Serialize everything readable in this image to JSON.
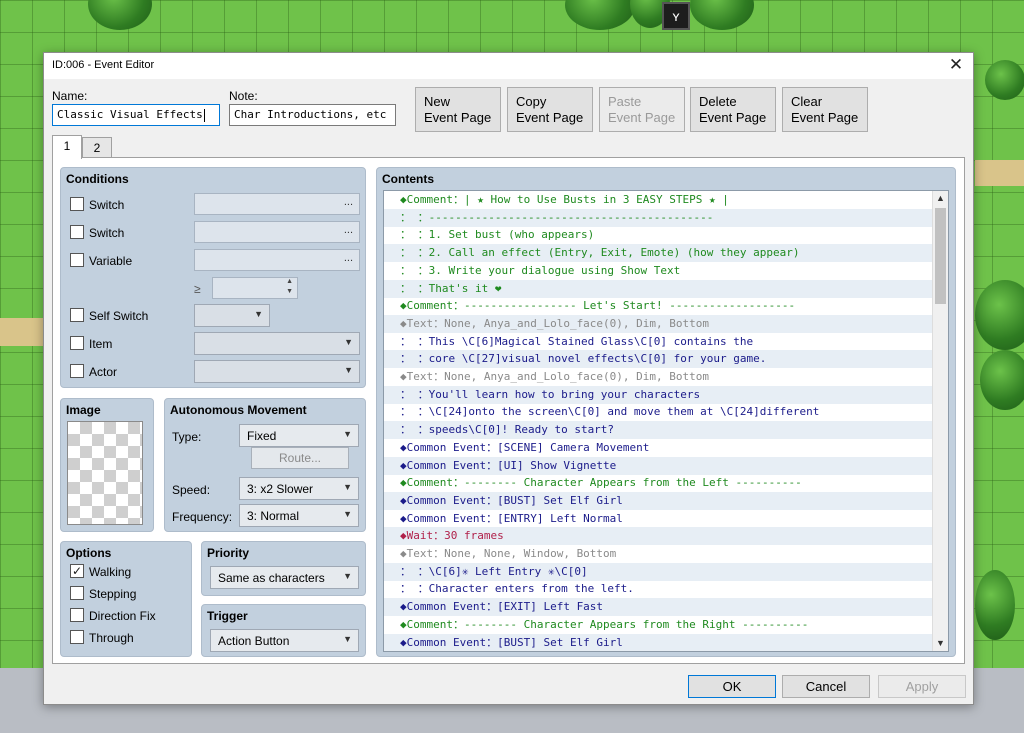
{
  "window": {
    "title": "ID:006 - Event Editor",
    "close": "✕"
  },
  "name": {
    "label": "Name:",
    "value": "Classic Visual Effects"
  },
  "note": {
    "label": "Note:",
    "value": "Char Introductions, etc"
  },
  "page_buttons": [
    {
      "line1": "New",
      "line2": "Event Page",
      "enabled": true
    },
    {
      "line1": "Copy",
      "line2": "Event Page",
      "enabled": true
    },
    {
      "line1": "Paste",
      "line2": "Event Page",
      "enabled": false
    },
    {
      "line1": "Delete",
      "line2": "Event Page",
      "enabled": true
    },
    {
      "line1": "Clear",
      "line2": "Event Page",
      "enabled": true
    }
  ],
  "tabs": [
    "1",
    "2"
  ],
  "conditions": {
    "title": "Conditions",
    "switch1": "Switch",
    "switch2": "Switch",
    "variable": "Variable",
    "gte": "≥",
    "self_switch": "Self Switch",
    "item": "Item",
    "actor": "Actor",
    "ellipsis": "...",
    "stepper_up": "▲",
    "stepper_down": "▼"
  },
  "image": {
    "title": "Image"
  },
  "autonomous": {
    "title": "Autonomous Movement",
    "type_label": "Type:",
    "type_value": "Fixed",
    "route": "Route...",
    "speed_label": "Speed:",
    "speed_value": "3: x2 Slower",
    "frequency_label": "Frequency:",
    "frequency_value": "3: Normal"
  },
  "options": {
    "title": "Options",
    "walking": "Walking",
    "walking_checked": "✓",
    "stepping": "Stepping",
    "direction_fix": "Direction Fix",
    "through": "Through"
  },
  "priority": {
    "title": "Priority",
    "value": "Same as characters"
  },
  "trigger": {
    "title": "Trigger",
    "value": "Action Button"
  },
  "contents": {
    "title": "Contents",
    "lines": [
      {
        "text": "◆Comment：|  ★ How to Use Busts in 3 EASY STEPS ★ |",
        "color": "#1f8a1f"
      },
      {
        "text": "：         ：-------------------------------------------",
        "color": "#1f8a1f"
      },
      {
        "text": "：         ：1. Set bust (who appears)",
        "color": "#1f8a1f"
      },
      {
        "text": "：         ：2. Call an effect (Entry, Exit, Emote) (how they appear)",
        "color": "#1f8a1f"
      },
      {
        "text": "：         ：3. Write your dialogue using Show Text",
        "color": "#1f8a1f"
      },
      {
        "text": "：         ：That's it ❤",
        "color": "#1f8a1f"
      },
      {
        "text": "◆Comment：----------------- Let's Start! -------------------",
        "color": "#1f8a1f"
      },
      {
        "text": "◆Text：None, Anya_and_Lolo_face(0), Dim, Bottom",
        "color": "#8a8a8a"
      },
      {
        "text": "：     ：This \\C[6]Magical Stained Glass\\C[0] contains the",
        "color": "#1b1b8a"
      },
      {
        "text": "：     ：core \\C[27]visual novel effects\\C[0] for your game.",
        "color": "#1b1b8a"
      },
      {
        "text": "◆Text：None, Anya_and_Lolo_face(0), Dim, Bottom",
        "color": "#8a8a8a"
      },
      {
        "text": "：     ：You'll learn how to bring your characters",
        "color": "#1b1b8a"
      },
      {
        "text": "：     ：\\C[24]onto the screen\\C[0] and move them at \\C[24]different",
        "color": "#1b1b8a"
      },
      {
        "text": "：     ：speeds\\C[0]! Ready to start?",
        "color": "#1b1b8a"
      },
      {
        "text": "◆Common Event：[SCENE] Camera Movement",
        "color": "#1b1b8a"
      },
      {
        "text": "◆Common Event：[UI] Show Vignette",
        "color": "#1b1b8a"
      },
      {
        "text": "◆Comment：-------- Character Appears from the Left ----------",
        "color": "#1f8a1f"
      },
      {
        "text": "◆Common Event：[BUST] Set Elf Girl",
        "color": "#1b1b8a"
      },
      {
        "text": "◆Common Event：[ENTRY] Left Normal",
        "color": "#1b1b8a"
      },
      {
        "text": "◆Wait：30 frames",
        "color": "#b0204a"
      },
      {
        "text": "◆Text：None, None, Window, Bottom",
        "color": "#8a8a8a"
      },
      {
        "text": "：     ：\\C[6]✳ Left Entry ✳\\C[0]",
        "color": "#1b1b8a"
      },
      {
        "text": "：     ：Character enters from the left.",
        "color": "#1b1b8a"
      },
      {
        "text": "◆Common Event：[EXIT] Left Fast",
        "color": "#1b1b8a"
      },
      {
        "text": "◆Comment：-------- Character Appears from the Right ----------",
        "color": "#1f8a1f"
      },
      {
        "text": "◆Common Event：[BUST] Set Elf Girl",
        "color": "#1b1b8a"
      }
    ],
    "scroll_up": "▲",
    "scroll_down": "▼"
  },
  "dialog_buttons": {
    "ok": "OK",
    "cancel": "Cancel",
    "apply": "Apply"
  }
}
